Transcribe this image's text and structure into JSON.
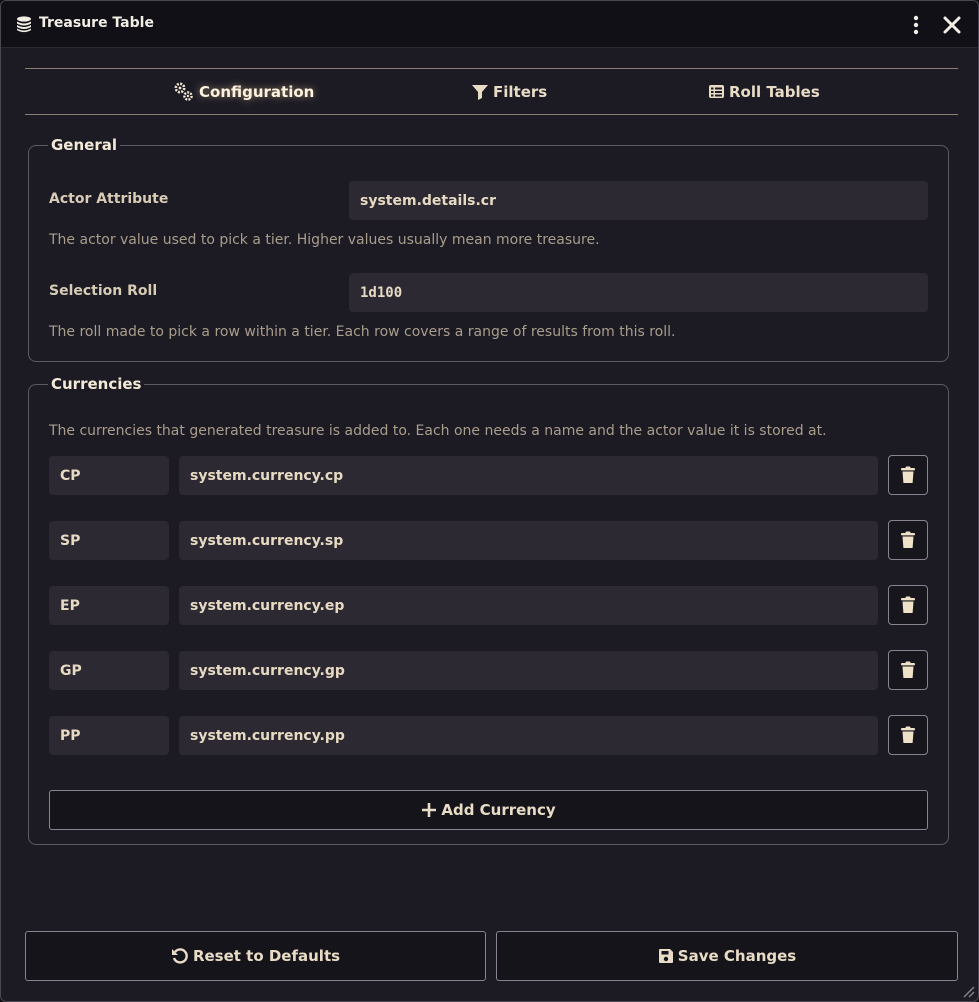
{
  "window": {
    "title": "Treasure Table",
    "title_icon": "coins-icon",
    "menu_icon": "ellipsis-vertical-icon",
    "close_icon": "close-icon"
  },
  "tabs": [
    {
      "label": "Configuration",
      "icon": "cogs-icon",
      "active": true
    },
    {
      "label": "Filters",
      "icon": "filter-icon",
      "active": false
    },
    {
      "label": "Roll Tables",
      "icon": "table-list-icon",
      "active": false
    }
  ],
  "general": {
    "legend": "General",
    "actor_attribute": {
      "label": "Actor Attribute",
      "value": "system.details.cr",
      "hint": "The actor value used to pick a tier. Higher values usually mean more treasure."
    },
    "selection_roll": {
      "label": "Selection Roll",
      "value": "1d100",
      "hint": "The roll made to pick a row within a tier. Each row covers a range of results from this roll."
    }
  },
  "currencies": {
    "legend": "Currencies",
    "hint": "The currencies that generated treasure is added to. Each one needs a name and the actor value it is stored at.",
    "items": [
      {
        "name": "CP",
        "path": "system.currency.cp"
      },
      {
        "name": "SP",
        "path": "system.currency.sp"
      },
      {
        "name": "EP",
        "path": "system.currency.ep"
      },
      {
        "name": "GP",
        "path": "system.currency.gp"
      },
      {
        "name": "PP",
        "path": "system.currency.pp"
      }
    ],
    "add_label": "Add Currency"
  },
  "footer": {
    "reset_label": "Reset to Defaults",
    "save_label": "Save Changes"
  },
  "colors": {
    "background": "#1c1b24",
    "titlebar": "#101016",
    "input_bg": "#2d2932",
    "text": "#e8dcc6",
    "hint": "#a99d8b",
    "accent_trash": "#f0e2c8"
  }
}
